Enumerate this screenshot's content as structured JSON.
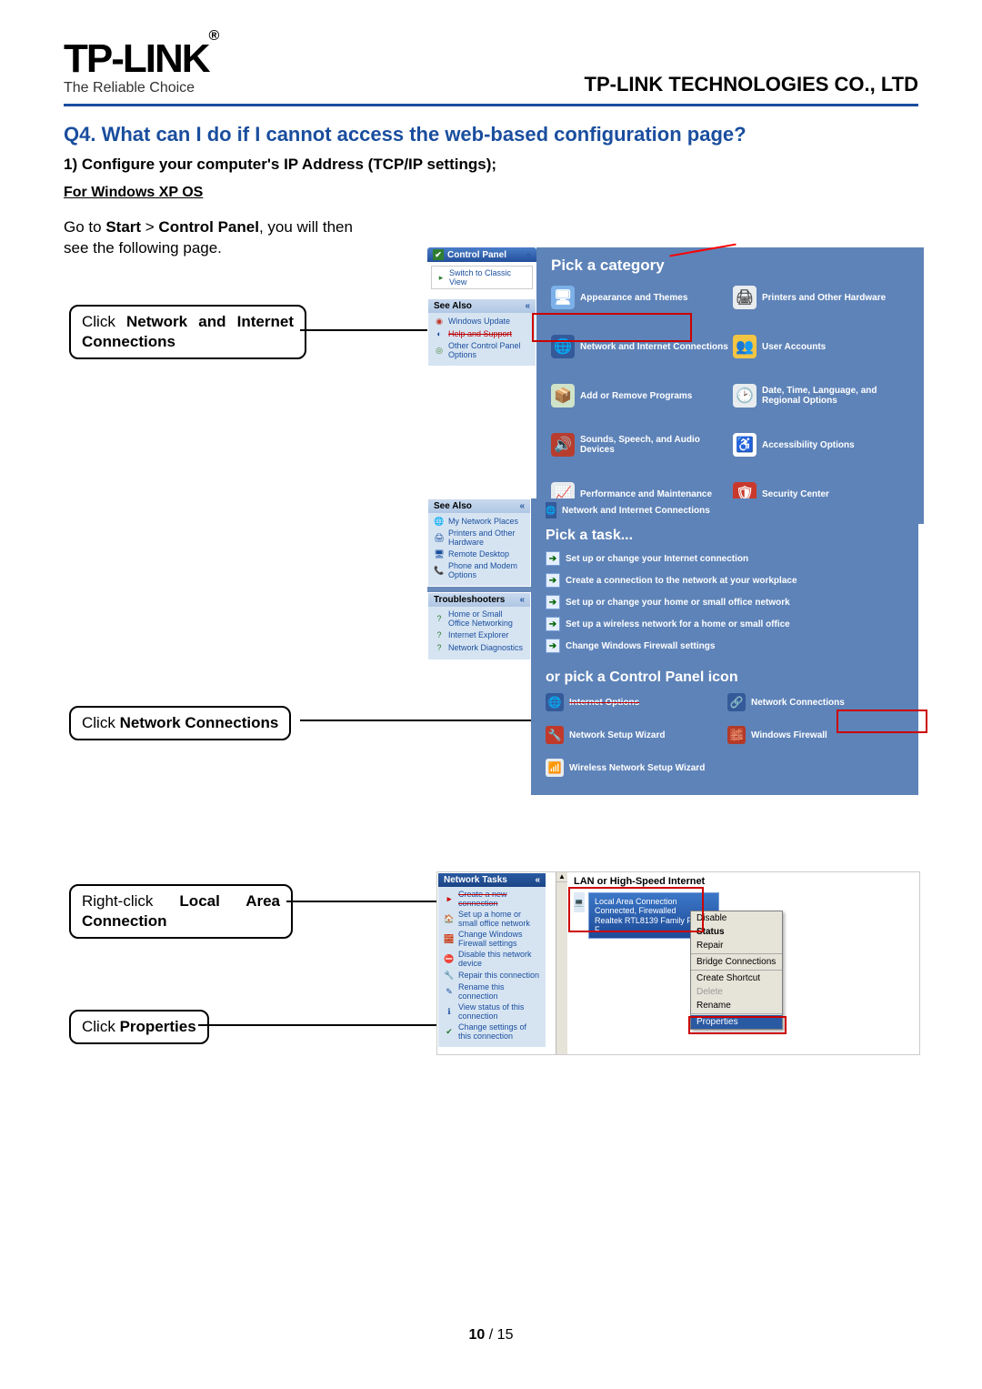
{
  "brand": "TP-LINK",
  "brand_sup": "®",
  "tagline": "The Reliable Choice",
  "company": "TP-LINK TECHNOLOGIES CO., LTD",
  "q_title": "Q4. What can I do if I cannot access the web-based configuration page?",
  "step1": "1) Configure your computer's IP Address (TCP/IP settings);",
  "os": "For Windows XP OS",
  "intro_pre": "Go to ",
  "intro_b1": "Start",
  "intro_sep": " > ",
  "intro_b2": "Control Panel",
  "intro_post": ", you will then see the following page.",
  "call1_pre": "Click ",
  "call1_b": "Network and Internet Connections",
  "call2_pre": "Click ",
  "call2_b": "Network Connections",
  "call3_pre": "Right-click ",
  "call3_b": "Local Area Connection",
  "call4_pre": "Click ",
  "call4_b": "Properties",
  "footer_a": "10",
  "footer_sep": " / ",
  "footer_b": "15",
  "shot1": {
    "title": "Control Panel",
    "switch": "Switch to Classic View",
    "seeAlso": "See Also",
    "seeAlsoItems": [
      "Windows Update",
      "Help and Support",
      "Other Control Panel Options"
    ],
    "heading": "Pick a category",
    "cats": [
      "Appearance and Themes",
      "Printers and Other Hardware",
      "Network and Internet Connections",
      "User Accounts",
      "Add or Remove Programs",
      "Date, Time, Language, and Regional Options",
      "Sounds, Speech, and Audio Devices",
      "Accessibility Options",
      "Performance and Maintenance",
      "Security Center"
    ]
  },
  "shot2": {
    "seeAlso": "See Also",
    "seeAlsoItems": [
      "My Network Places",
      "Printers and Other Hardware",
      "Remote Desktop",
      "Phone and Modem Options"
    ],
    "trouble": "Troubleshooters",
    "troubleItems": [
      "Home or Small Office Networking",
      "Internet Explorer",
      "Network Diagnostics"
    ],
    "crumb": "Network and Internet Connections",
    "pickTask": "Pick a task...",
    "tasks": [
      "Set up or change your Internet connection",
      "Create a connection to the network at your workplace",
      "Set up or change your home or small office network",
      "Set up a wireless network for a home or small office",
      "Change Windows Firewall settings"
    ],
    "orPick": "or pick a Control Panel icon",
    "icons": [
      "Internet Options",
      "Network Connections",
      "Network Setup Wizard",
      "Windows Firewall",
      "Wireless Network Setup Wizard"
    ]
  },
  "shot3": {
    "tasksH": "Network Tasks",
    "tasks": [
      "Create a new connection",
      "Set up a home or small office network",
      "Change Windows Firewall settings",
      "Disable this network device",
      "Repair this connection",
      "Rename this connection",
      "View status of this connection",
      "Change settings of this connection"
    ],
    "lanH": "LAN or High-Speed Internet",
    "lanName": "Local Area Connection",
    "lanStatus": "Connected, Firewalled",
    "lanDev": "Realtek RTL8139 Family PCI F...",
    "ctx": [
      "Disable",
      "Status",
      "Repair",
      "Bridge Connections",
      "Create Shortcut",
      "Delete",
      "Rename",
      "Properties"
    ]
  }
}
